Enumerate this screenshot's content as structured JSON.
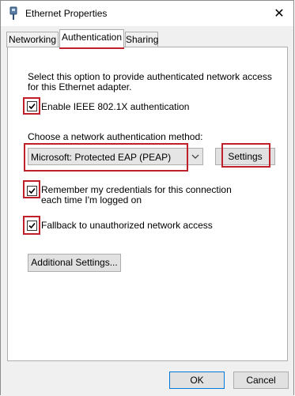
{
  "window": {
    "title": "Ethernet Properties",
    "close_glyph": "✕"
  },
  "tabs": [
    {
      "label": "Networking",
      "active": false
    },
    {
      "label": "Authentication",
      "active": true
    },
    {
      "label": "Sharing",
      "active": false
    }
  ],
  "auth": {
    "description": "Select this option to provide authenticated network access for this Ethernet adapter.",
    "enable_8021x": {
      "label": "Enable IEEE 802.1X authentication",
      "checked": true
    },
    "method_label": "Choose a network authentication method:",
    "method_selected": "Microsoft: Protected EAP (PEAP)",
    "settings_button": "Settings",
    "remember_credentials": {
      "label": "Remember my credentials for this connection each time I'm logged on",
      "checked": true
    },
    "fallback": {
      "label": "Fallback to unauthorized network access",
      "checked": true
    },
    "additional_settings_button": "Additional Settings..."
  },
  "footer": {
    "ok_label": "OK",
    "cancel_label": "Cancel"
  },
  "colors": {
    "highlight": "#c0202a",
    "accent": "#0078d7"
  },
  "icons": {
    "title": "network-adapter-icon",
    "close": "close-icon",
    "checkbox": "checkmark-icon",
    "dropdown": "chevron-down-icon"
  }
}
